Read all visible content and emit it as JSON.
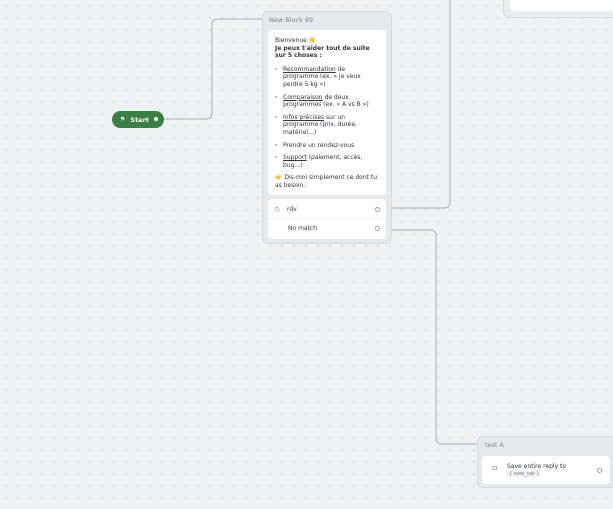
{
  "canvas": {
    "background": "#eff2f4"
  },
  "start_node": {
    "flag": "⚑",
    "label": "Start",
    "color": "#3c7f43"
  },
  "block_main": {
    "title": "New Block 89",
    "message": {
      "greeting": "Bienvenue 👋",
      "intro": "Je peux t'aider tout de suite sur 5 choses :",
      "items": [
        {
          "link": "Recommandation",
          "rest": " de programme (ex. « je veux perdre 5 kg »)"
        },
        {
          "link": "Comparaison",
          "rest": " de deux programmes (ex. « A vs B »)"
        },
        {
          "link": "Infos précises",
          "rest": " sur un programme (prix, durée, matériel…)"
        },
        {
          "link": "",
          "rest": "Prendre un rendez-vous"
        },
        {
          "link": "Support",
          "rest": " (paiement, accès, bug…)"
        }
      ],
      "closing": "👉 Dis-moi simplement ce dont tu as besoin."
    },
    "choices": [
      {
        "icon": "◷",
        "label": "rdv"
      },
      {
        "icon": "",
        "label": "No match"
      }
    ]
  },
  "block_test": {
    "title": "test A",
    "card": {
      "icon": "⊡",
      "label": "Save entire reply to",
      "variable": "{ new_var }"
    }
  },
  "colors": {
    "edge": "#a3acb5",
    "node_bg": "#e4e9ee",
    "card_bg": "#ffffff"
  }
}
